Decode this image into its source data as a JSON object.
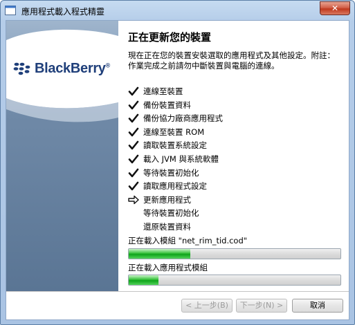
{
  "window": {
    "title": "應用程式載入程式精靈",
    "close_label": "✕"
  },
  "brand": {
    "name": "BlackBerry",
    "suffix": "®"
  },
  "content": {
    "heading": "正在更新您的裝置",
    "description": "現在正在您的裝置安裝選取的應用程式及其他設定。附註：作業完成之前請勿中斷裝置與電腦的連線。"
  },
  "steps": [
    {
      "label": "連線至裝置",
      "status": "done"
    },
    {
      "label": "備份裝置資料",
      "status": "done"
    },
    {
      "label": "備份協力廠商應用程式",
      "status": "done"
    },
    {
      "label": "連線至裝置 ROM",
      "status": "done"
    },
    {
      "label": "讀取裝置系統設定",
      "status": "done"
    },
    {
      "label": "載入 JVM 與系統軟體",
      "status": "done"
    },
    {
      "label": "等待裝置初始化",
      "status": "done"
    },
    {
      "label": "讀取應用程式設定",
      "status": "done"
    },
    {
      "label": "更新應用程式",
      "status": "current"
    },
    {
      "label": "等待裝置初始化",
      "status": "pending"
    },
    {
      "label": "還原裝置資料",
      "status": "pending"
    }
  ],
  "progress": [
    {
      "label": "正在載入模組 \"net_rim_tid.cod\"",
      "value": 0.29
    },
    {
      "label": "正在載入應用程式模組",
      "value": 0.14
    }
  ],
  "buttons": {
    "back": "< 上一步(B)",
    "next": "下一步(N) >",
    "cancel": "取消"
  },
  "colors": {
    "progress_green": "#0ea31a",
    "brand_blue": "#1f3f7a"
  }
}
